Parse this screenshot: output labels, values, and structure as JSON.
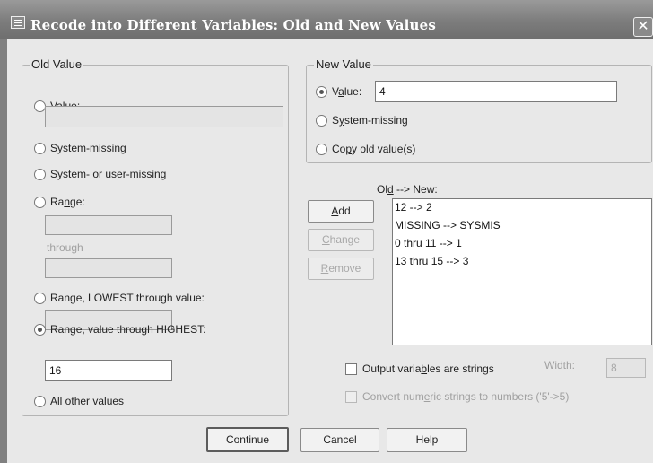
{
  "window": {
    "title": "Recode into Different Variables: Old and New Values",
    "close_glyph": "✕"
  },
  "old_value": {
    "legend": "Old Value",
    "value_label": "Value:",
    "value_input": "",
    "system_missing": "System-missing",
    "system_or_user_missing": "System- or user-missing",
    "range_label": "Range:",
    "range_from": "",
    "through_label": "through",
    "range_to": "",
    "range_lowest_label": "Range, LOWEST through value:",
    "range_lowest_input": "",
    "range_highest_label": "Range, value through HIGHEST:",
    "range_highest_input": "16",
    "all_other": "All other values",
    "selected": "range_highest"
  },
  "new_value": {
    "legend": "New Value",
    "value_label": "Value:",
    "value_input": "4",
    "system_missing": "System-missing",
    "copy_old": "Copy old value(s)",
    "selected": "value"
  },
  "mapping": {
    "header": "Old --> New:",
    "items": [
      "12 --> 2",
      "MISSING --> SYSMIS",
      "0 thru 11 --> 1",
      "13 thru 15 --> 3"
    ],
    "add": "Add",
    "change": "Change",
    "remove": "Remove"
  },
  "options": {
    "output_strings": "Output variables are strings",
    "width_label": "Width:",
    "width_value": "8",
    "convert_numeric": "Convert numeric strings to numbers ('5'->5)"
  },
  "footer": {
    "continue": "Continue",
    "cancel": "Cancel",
    "help": "Help"
  }
}
